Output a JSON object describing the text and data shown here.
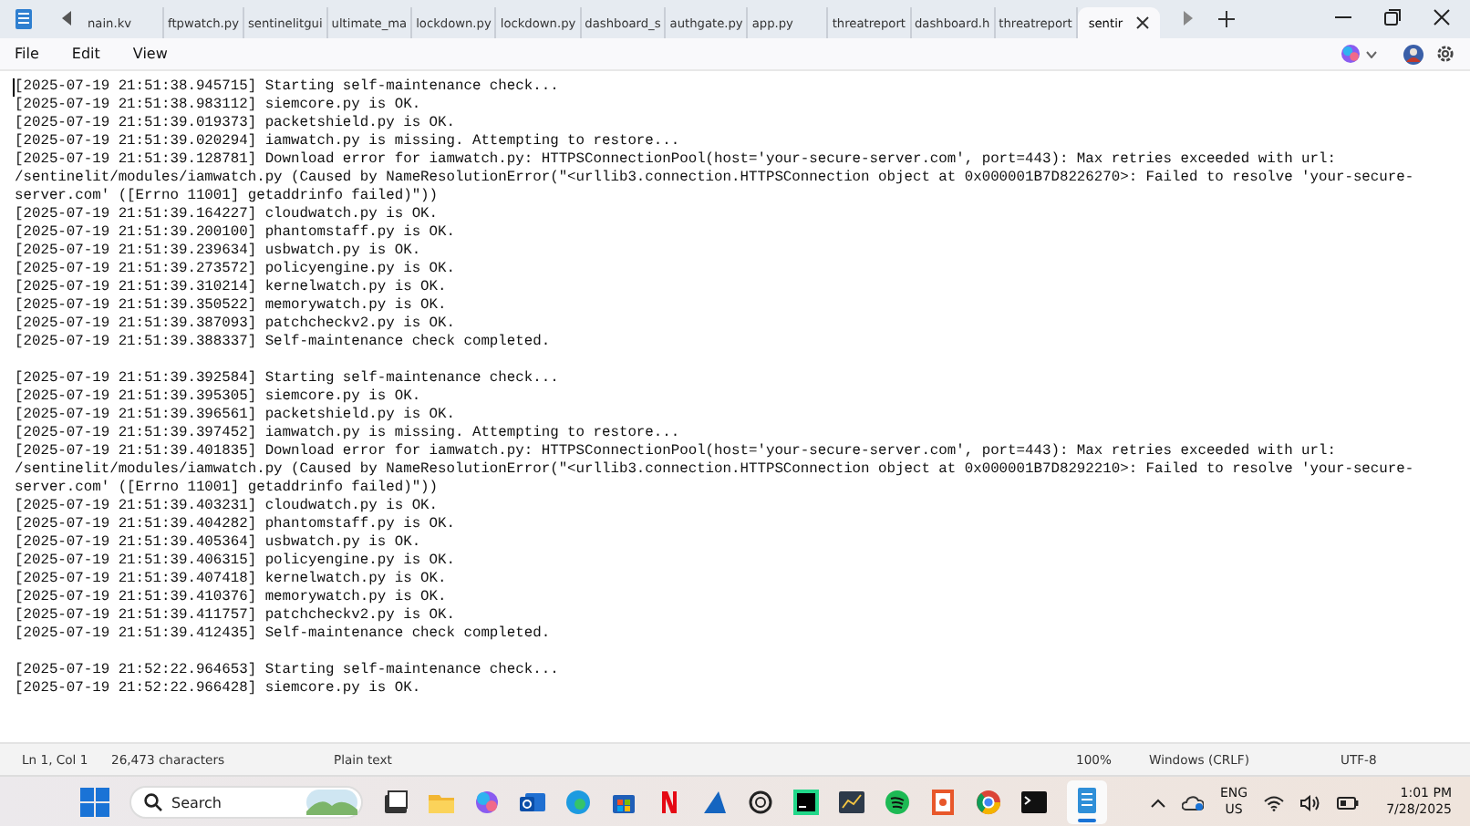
{
  "tabs": [
    {
      "label": "nain.kv",
      "selected": false
    },
    {
      "label": "ftpwatch.py",
      "selected": false
    },
    {
      "label": "sentinelitgui",
      "selected": false
    },
    {
      "label": "ultimate_ma",
      "selected": false
    },
    {
      "label": "lockdown.py",
      "selected": false
    },
    {
      "label": "lockdown.py",
      "selected": false
    },
    {
      "label": "dashboard_s",
      "selected": false
    },
    {
      "label": "authgate.py",
      "selected": false
    },
    {
      "label": "app.py",
      "selected": false
    },
    {
      "label": "threatreport",
      "selected": false
    },
    {
      "label": "dashboard.h",
      "selected": false
    },
    {
      "label": "threatreport",
      "selected": false
    },
    {
      "label": "sentir",
      "selected": true
    }
  ],
  "menu": [
    "File",
    "Edit",
    "View"
  ],
  "document": {
    "blocks": [
      [
        "[2025-07-19 21:51:38.945715] Starting self-maintenance check...",
        "[2025-07-19 21:51:38.983112] siemcore.py is OK.",
        "[2025-07-19 21:51:39.019373] packetshield.py is OK.",
        "[2025-07-19 21:51:39.020294] iamwatch.py is missing. Attempting to restore...",
        "[2025-07-19 21:51:39.128781] Download error for iamwatch.py: HTTPSConnectionPool(host='your-secure-server.com', port=443): Max retries exceeded with url: /sentinelit/modules/iamwatch.py (Caused by NameResolutionError(\"<urllib3.connection.HTTPSConnection object at 0x000001B7D8226270>: Failed to resolve 'your-secure-server.com' ([Errno 11001] getaddrinfo failed)\"))",
        "[2025-07-19 21:51:39.164227] cloudwatch.py is OK.",
        "[2025-07-19 21:51:39.200100] phantomstaff.py is OK.",
        "[2025-07-19 21:51:39.239634] usbwatch.py is OK.",
        "[2025-07-19 21:51:39.273572] policyengine.py is OK.",
        "[2025-07-19 21:51:39.310214] kernelwatch.py is OK.",
        "[2025-07-19 21:51:39.350522] memorywatch.py is OK.",
        "[2025-07-19 21:51:39.387093] patchcheckv2.py is OK.",
        "[2025-07-19 21:51:39.388337] Self-maintenance check completed."
      ],
      [
        "[2025-07-19 21:51:39.392584] Starting self-maintenance check...",
        "[2025-07-19 21:51:39.395305] siemcore.py is OK.",
        "[2025-07-19 21:51:39.396561] packetshield.py is OK.",
        "[2025-07-19 21:51:39.397452] iamwatch.py is missing. Attempting to restore...",
        "[2025-07-19 21:51:39.401835] Download error for iamwatch.py: HTTPSConnectionPool(host='your-secure-server.com', port=443): Max retries exceeded with url: /sentinelit/modules/iamwatch.py (Caused by NameResolutionError(\"<urllib3.connection.HTTPSConnection object at 0x000001B7D8292210>: Failed to resolve 'your-secure-server.com' ([Errno 11001] getaddrinfo failed)\"))",
        "[2025-07-19 21:51:39.403231] cloudwatch.py is OK.",
        "[2025-07-19 21:51:39.404282] phantomstaff.py is OK.",
        "[2025-07-19 21:51:39.405364] usbwatch.py is OK.",
        "[2025-07-19 21:51:39.406315] policyengine.py is OK.",
        "[2025-07-19 21:51:39.407418] kernelwatch.py is OK.",
        "[2025-07-19 21:51:39.410376] memorywatch.py is OK.",
        "[2025-07-19 21:51:39.411757] patchcheckv2.py is OK.",
        "[2025-07-19 21:51:39.412435] Self-maintenance check completed."
      ],
      [
        "[2025-07-19 21:52:22.964653] Starting self-maintenance check...",
        "[2025-07-19 21:52:22.966428] siemcore.py is OK."
      ]
    ]
  },
  "status_bar": {
    "position": "Ln 1, Col 1",
    "characters": "26,473 characters",
    "format": "Plain text",
    "zoom": "100%",
    "line_ending": "Windows (CRLF)",
    "encoding": "UTF-8"
  },
  "taskbar": {
    "search": {
      "placeholder": "Search"
    },
    "language": "ENG",
    "region": "US",
    "time": "1:01 PM",
    "date": "7/28/2025"
  }
}
